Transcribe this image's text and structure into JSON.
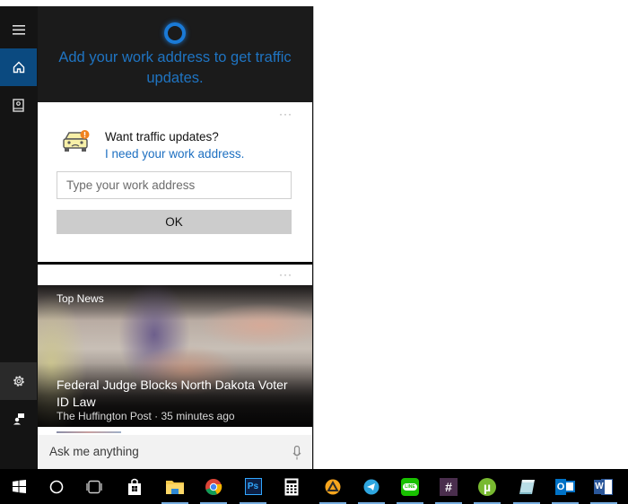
{
  "sidebar": {
    "items": [
      {
        "name": "menu",
        "icon": "hamburger-icon"
      },
      {
        "name": "home",
        "icon": "home-icon",
        "active": true
      },
      {
        "name": "notebook",
        "icon": "notebook-icon"
      },
      {
        "name": "settings",
        "icon": "gear-icon"
      },
      {
        "name": "feedback",
        "icon": "feedback-icon"
      }
    ]
  },
  "header": {
    "logo": "cortana-ring-icon",
    "message": "Add your work address to get traffic updates.",
    "accent_color": "#1f74c2"
  },
  "traffic_card": {
    "more_label": "···",
    "title": "Want traffic updates?",
    "subtitle": "I need your work address.",
    "input_placeholder": "Type your work address",
    "input_value": "",
    "ok_label": "OK"
  },
  "news_card": {
    "more_label": "···",
    "tag": "Top News",
    "headline": "Federal Judge Blocks North Dakota Voter ID Law",
    "source": "The Huffington Post · 35 minutes ago"
  },
  "search": {
    "placeholder": "Ask me anything",
    "value": ""
  },
  "taskbar": {
    "items": [
      {
        "name": "start",
        "icon": "windows-logo-icon"
      },
      {
        "name": "cortana",
        "icon": "circle-icon"
      },
      {
        "name": "task-view",
        "icon": "task-view-icon"
      },
      {
        "name": "store",
        "icon": "store-bag-icon"
      },
      {
        "name": "file-explorer",
        "icon": "folder-icon",
        "running": true
      },
      {
        "name": "chrome",
        "icon": "chrome-icon",
        "running": true
      },
      {
        "name": "photoshop",
        "icon": "photoshop-icon",
        "label": "Ps",
        "running": true
      },
      {
        "name": "calculator",
        "icon": "calculator-icon"
      },
      {
        "name": "avast",
        "icon": "avast-icon",
        "running": true
      },
      {
        "name": "telegram",
        "icon": "telegram-icon",
        "running": true
      },
      {
        "name": "line",
        "icon": "line-icon",
        "label": "LINE",
        "running": true
      },
      {
        "name": "slack",
        "icon": "hash-icon",
        "label": "#",
        "running": true
      },
      {
        "name": "utorrent",
        "icon": "utorrent-icon",
        "label": "µ",
        "running": true
      },
      {
        "name": "notepad",
        "icon": "notepad-icon",
        "running": true
      },
      {
        "name": "outlook",
        "icon": "outlook-icon",
        "label": "O",
        "running": true
      },
      {
        "name": "word",
        "icon": "word-icon",
        "label": "W",
        "running": true
      }
    ]
  }
}
